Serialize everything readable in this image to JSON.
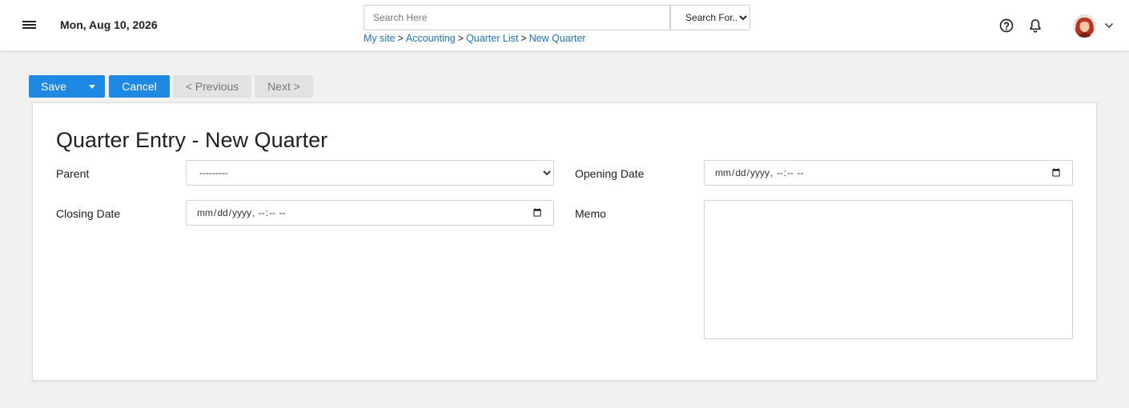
{
  "header": {
    "date": "Mon, Aug 10, 2026",
    "search": {
      "placeholder": "Search Here",
      "value": ""
    },
    "search_for": {
      "selected": "Search For..."
    },
    "breadcrumb": [
      {
        "label": "My site"
      },
      {
        "label": "Accounting"
      },
      {
        "label": "Quarter List"
      },
      {
        "label": "New Quarter"
      }
    ],
    "breadcrumb_separator": ">",
    "icons": {
      "menu": "menu-icon",
      "help": "help-icon",
      "notifications": "bell-icon",
      "expand": "chevron-down-icon"
    }
  },
  "toolbar": {
    "save_label": "Save",
    "cancel_label": "Cancel",
    "previous_label": "< Previous",
    "next_label": "Next >"
  },
  "form": {
    "title": "Quarter Entry - New Quarter",
    "parent": {
      "label": "Parent",
      "selected": "---------"
    },
    "opening_date": {
      "label": "Opening Date",
      "value": ""
    },
    "closing_date": {
      "label": "Closing Date",
      "value": ""
    },
    "memo": {
      "label": "Memo",
      "value": ""
    }
  },
  "colors": {
    "primary": "#1e88e5",
    "link": "#1a73c8",
    "disabled_bg": "#e2e2e2",
    "page_bg": "#f1f1f1"
  }
}
